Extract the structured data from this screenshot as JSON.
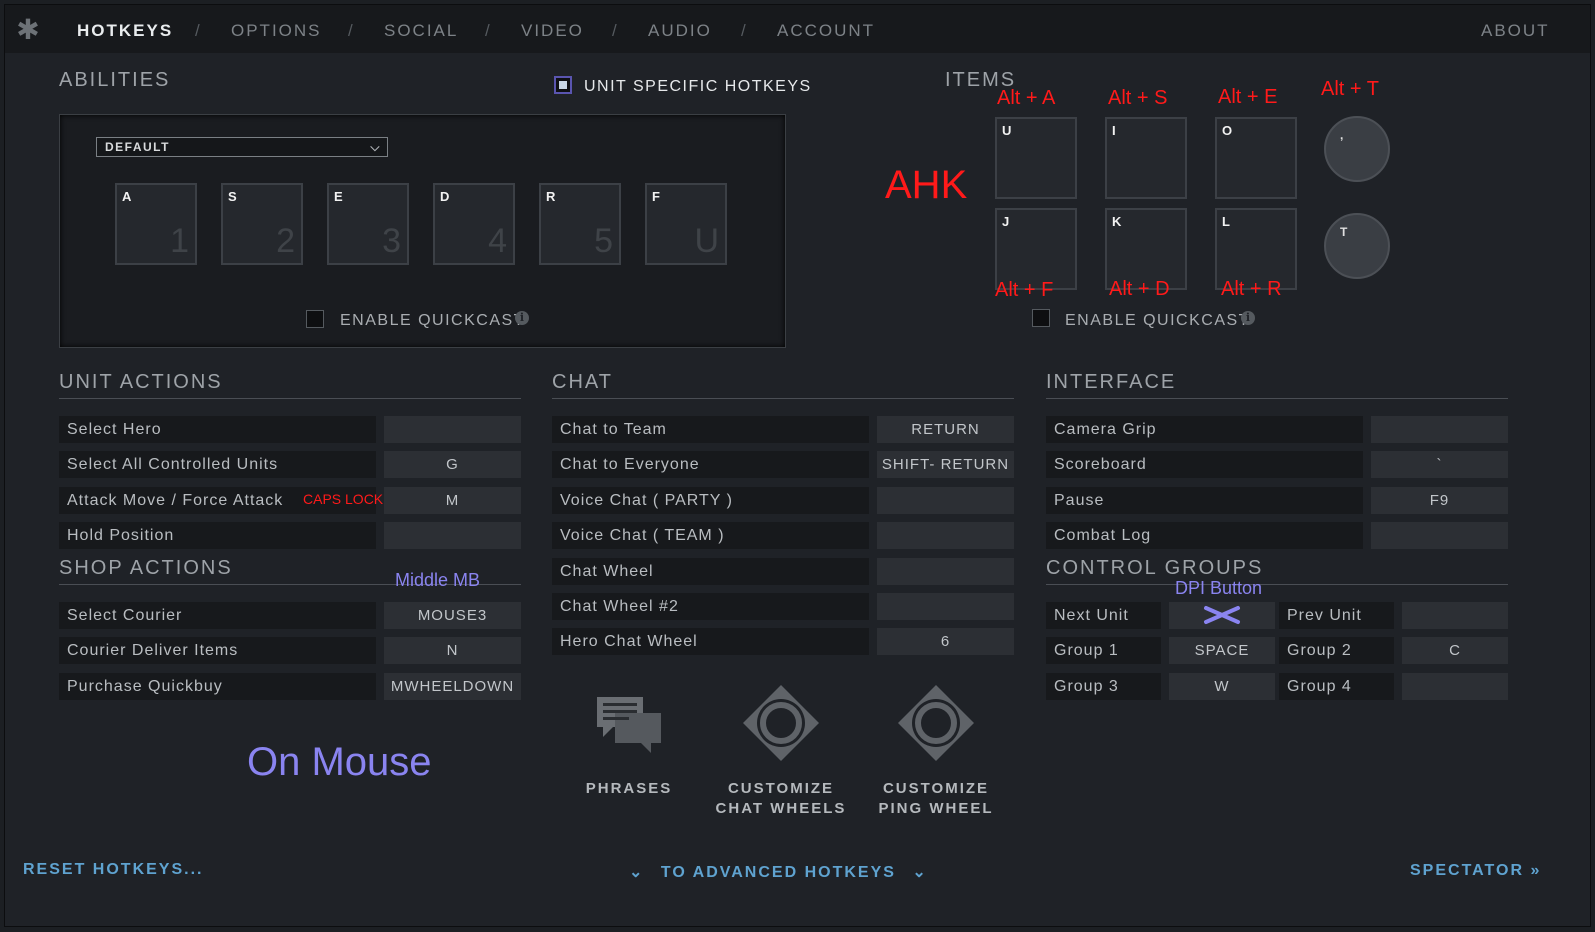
{
  "nav": {
    "tabs": [
      "HOTKEYS",
      "OPTIONS",
      "SOCIAL",
      "VIDEO",
      "AUDIO",
      "ACCOUNT"
    ],
    "separator": "/",
    "about": "ABOUT"
  },
  "abilities": {
    "title": "ABILITIES",
    "unit_specific": "UNIT SPECIFIC HOTKEYS",
    "dropdown": "DEFAULT",
    "slots": [
      {
        "key": "A",
        "num": "1"
      },
      {
        "key": "S",
        "num": "2"
      },
      {
        "key": "E",
        "num": "3"
      },
      {
        "key": "D",
        "num": "4"
      },
      {
        "key": "R",
        "num": "5"
      },
      {
        "key": "F",
        "num": "U"
      }
    ],
    "quickcast": "ENABLE QUICKCAST"
  },
  "items": {
    "title": "ITEMS",
    "slots": [
      "U",
      "I",
      "O",
      "J",
      "K",
      "L"
    ],
    "round": [
      ",",
      "T"
    ],
    "quickcast": "ENABLE QUICKCAST"
  },
  "annotations": {
    "ahk": "AHK",
    "alt_a": "Alt + A",
    "alt_s": "Alt + S",
    "alt_e": "Alt + E",
    "alt_t": "Alt + T",
    "alt_f": "Alt + F",
    "alt_d": "Alt + D",
    "alt_r": "Alt + R",
    "caps_lock": "CAPS LOCK",
    "middle_mb": "Middle MB",
    "dpi_button": "DPI Button",
    "on_mouse": "On Mouse"
  },
  "unit_actions": {
    "title": "UNIT ACTIONS",
    "rows": [
      {
        "label": "Select Hero",
        "key": ""
      },
      {
        "label": "Select All Controlled Units",
        "key": "G"
      },
      {
        "label": "Attack Move / Force Attack",
        "key": "M"
      },
      {
        "label": "Hold Position",
        "key": ""
      }
    ]
  },
  "shop_actions": {
    "title": "SHOP ACTIONS",
    "rows": [
      {
        "label": "Select Courier",
        "key": "MOUSE3"
      },
      {
        "label": "Courier Deliver Items",
        "key": "N"
      },
      {
        "label": "Purchase Quickbuy",
        "key": "MWHEELDOWN"
      }
    ]
  },
  "chat": {
    "title": "CHAT",
    "rows": [
      {
        "label": "Chat to Team",
        "key": "RETURN"
      },
      {
        "label": "Chat to Everyone",
        "key": "SHIFT- RETURN"
      },
      {
        "label": "Voice Chat ( PARTY )",
        "key": ""
      },
      {
        "label": "Voice Chat ( TEAM )",
        "key": ""
      },
      {
        "label": "Chat Wheel",
        "key": ""
      },
      {
        "label": "Chat Wheel #2",
        "key": ""
      },
      {
        "label": "Hero Chat Wheel",
        "key": "6"
      }
    ],
    "buttons": {
      "phrases": "PHRASES",
      "chat_wheels_1": "CUSTOMIZE",
      "chat_wheels_2": "CHAT WHEELS",
      "ping_wheel_1": "CUSTOMIZE",
      "ping_wheel_2": "PING WHEEL"
    }
  },
  "interface": {
    "title": "INTERFACE",
    "rows": [
      {
        "label": "Camera Grip",
        "key": ""
      },
      {
        "label": "Scoreboard",
        "key": "`"
      },
      {
        "label": "Pause",
        "key": "F9"
      },
      {
        "label": "Combat Log",
        "key": ""
      }
    ]
  },
  "control_groups": {
    "title": "CONTROL GROUPS",
    "rows": [
      {
        "left_label": "Next Unit",
        "left_key": "",
        "right_label": "Prev Unit",
        "right_key": ""
      },
      {
        "left_label": "Group 1",
        "left_key": "SPACE",
        "right_label": "Group 2",
        "right_key": "C"
      },
      {
        "left_label": "Group 3",
        "left_key": "W",
        "right_label": "Group 4",
        "right_key": ""
      }
    ]
  },
  "footer": {
    "reset": "RESET HOTKEYS...",
    "advanced": "TO ADVANCED HOTKEYS",
    "spectator": "SPECTATOR"
  },
  "colors": {
    "annotation_red": "#ff1a1a",
    "annotation_blue": "#8a84f0",
    "link_blue": "#5fa3d0"
  }
}
